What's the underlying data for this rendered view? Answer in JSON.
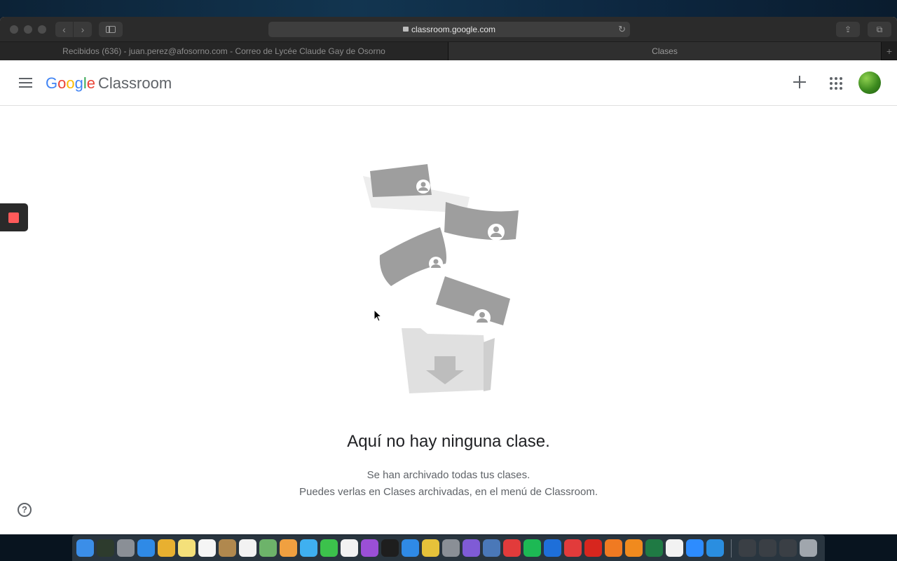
{
  "browser": {
    "url": "classroom.google.com",
    "tabs": [
      {
        "label": "Recibidos (636) - juan.perez@afosorno.com - Correo de Lycée Claude Gay de Osorno",
        "active": false
      },
      {
        "label": "Clases",
        "active": true
      }
    ],
    "add_tab": "+"
  },
  "app": {
    "brand_letters": [
      "G",
      "o",
      "o",
      "g",
      "l",
      "e"
    ],
    "product": "Classroom"
  },
  "empty_state": {
    "title": "Aquí no hay ninguna clase.",
    "line1": "Se han archivado todas tus clases.",
    "line2": "Puedes verlas en Clases archivadas, en el menú de Classroom."
  },
  "help": "?",
  "icons": {
    "back": "chevron-left-icon",
    "forward": "chevron-right-icon",
    "reload": "reload-icon",
    "lock": "lock-icon"
  },
  "colors": {
    "google_blue": "#4285f4",
    "google_red": "#ea4335",
    "google_yellow": "#fbbc05",
    "google_green": "#34a853",
    "record_red": "#ff5a5a"
  },
  "dock_apps": [
    {
      "name": "finder",
      "color": "#3b8ee8"
    },
    {
      "name": "activity-monitor",
      "color": "#2d3b2d"
    },
    {
      "name": "launchpad",
      "color": "#8a8f96"
    },
    {
      "name": "safari",
      "color": "#2f8ae6"
    },
    {
      "name": "chrome",
      "color": "#e8b030"
    },
    {
      "name": "notes",
      "color": "#f4e07a"
    },
    {
      "name": "calendar",
      "color": "#f5f5f5"
    },
    {
      "name": "contacts",
      "color": "#b0884e"
    },
    {
      "name": "reminders",
      "color": "#f2f2f2"
    },
    {
      "name": "maps",
      "color": "#6db36a"
    },
    {
      "name": "photos",
      "color": "#f0a040"
    },
    {
      "name": "messages",
      "color": "#3fb0f0"
    },
    {
      "name": "facetime",
      "color": "#3cc24c"
    },
    {
      "name": "music",
      "color": "#f2f2f2"
    },
    {
      "name": "podcasts",
      "color": "#9b4fd6"
    },
    {
      "name": "apple-tv",
      "color": "#1e1e1e"
    },
    {
      "name": "app-store",
      "color": "#2f8ae6"
    },
    {
      "name": "stickies",
      "color": "#e6c23a"
    },
    {
      "name": "system-preferences",
      "color": "#8a8f96"
    },
    {
      "name": "quill",
      "color": "#7f5bd6"
    },
    {
      "name": "virtualbox",
      "color": "#4a78b8"
    },
    {
      "name": "xmind",
      "color": "#e23b3b"
    },
    {
      "name": "spotify",
      "color": "#1db954"
    },
    {
      "name": "teamviewer",
      "color": "#1e6fd9"
    },
    {
      "name": "anydesk",
      "color": "#e23b3b"
    },
    {
      "name": "acrobat",
      "color": "#d7261e"
    },
    {
      "name": "firefox",
      "color": "#f07a22"
    },
    {
      "name": "vlc",
      "color": "#f08a1e"
    },
    {
      "name": "excel",
      "color": "#1f7a44"
    },
    {
      "name": "textedit",
      "color": "#f2f2f2"
    },
    {
      "name": "zoom",
      "color": "#2d8cff"
    },
    {
      "name": "edge",
      "color": "#2a8ee0"
    },
    {
      "name": "folder-1",
      "color": "#3a3f45"
    },
    {
      "name": "folder-2",
      "color": "#3a3f45"
    },
    {
      "name": "folder-3",
      "color": "#3a3f45"
    },
    {
      "name": "trash",
      "color": "#a0a6ad"
    }
  ]
}
